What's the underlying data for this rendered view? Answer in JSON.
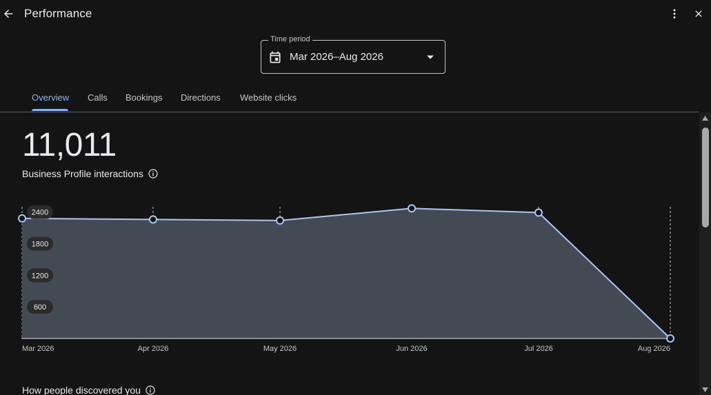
{
  "header": {
    "title": "Performance",
    "back_icon": "arrow-left-icon",
    "more_icon": "more-vert-icon",
    "close_icon": "close-icon"
  },
  "time_period": {
    "label": "Time period",
    "value": "Mar 2026–Aug 2026",
    "icon": "calendar-icon"
  },
  "tabs": [
    {
      "label": "Overview",
      "active": true
    },
    {
      "label": "Calls",
      "active": false
    },
    {
      "label": "Bookings",
      "active": false
    },
    {
      "label": "Directions",
      "active": false
    },
    {
      "label": "Website clicks",
      "active": false
    }
  ],
  "summary": {
    "total": "11,011",
    "label": "Business Profile interactions"
  },
  "chart_data": {
    "type": "area",
    "x": [
      "Mar 2026",
      "Apr 2026",
      "May 2026",
      "Jun 2026",
      "Jul 2026",
      "Aug 2026"
    ],
    "values": [
      2280,
      2260,
      2240,
      2470,
      2390,
      0
    ],
    "y_ticks": [
      600,
      1200,
      1800,
      2400
    ],
    "ylim": [
      0,
      2500
    ],
    "grid": "vertical dashed",
    "colors": {
      "line": "#a8c7fa",
      "fill": "#444a53",
      "axis": "#e8eaed"
    }
  },
  "section2": {
    "title": "How people discovered you"
  },
  "colors": {
    "background": "#141414",
    "accent": "#8ab4f8",
    "text": "#e8eaed"
  }
}
